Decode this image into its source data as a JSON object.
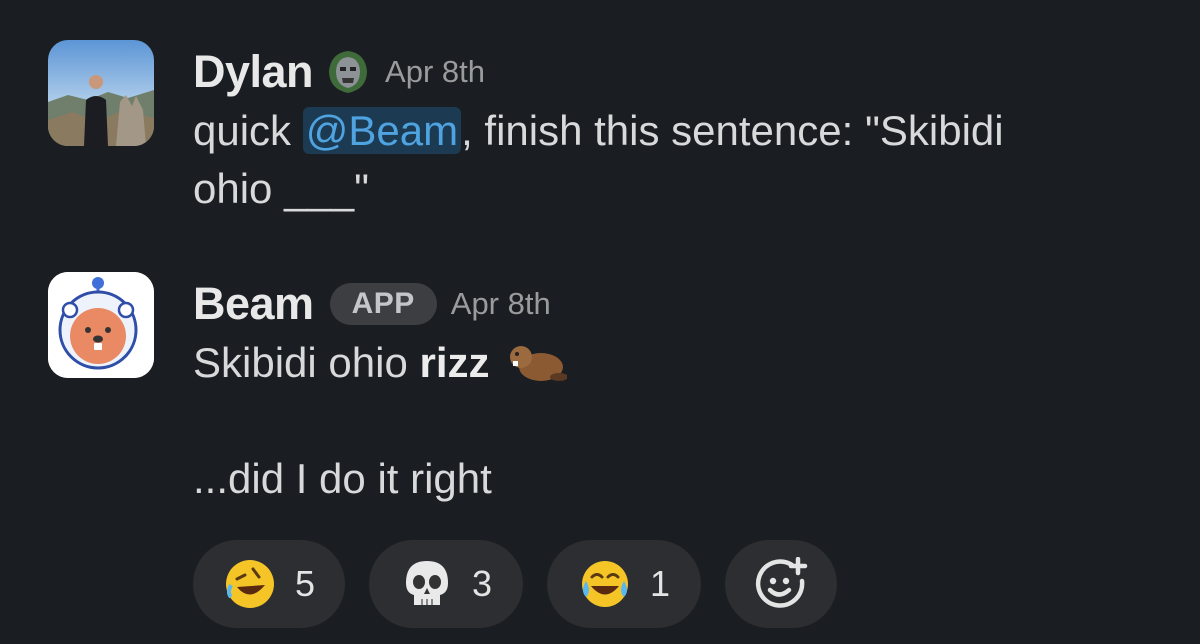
{
  "messages": [
    {
      "sender": "Dylan",
      "timestamp": "Apr 8th",
      "status_emoji": "doom-mask-icon",
      "text_before": "quick ",
      "mention": "@Beam",
      "text_after": ", finish this sentence: \"Skibidi",
      "text_line2": "ohio ___\""
    },
    {
      "sender": "Beam",
      "badge": "APP",
      "timestamp": "Apr 8th",
      "text_plain": "Skibidi ohio ",
      "text_bold": "rizz",
      "trailing_emoji": "beaver-icon",
      "text_line3": "...did I do it right"
    }
  ],
  "reactions": [
    {
      "emoji": "rolling-on-floor-laughing-icon",
      "count": "5"
    },
    {
      "emoji": "skull-icon",
      "count": "3"
    },
    {
      "emoji": "tears-of-joy-icon",
      "count": "1"
    }
  ],
  "add_reaction_icon": "add-reaction-icon",
  "colors": {
    "background": "#1a1d21",
    "mention_bg": "#1c3a52",
    "mention_text": "#4fa3e0",
    "reaction_bg": "#2c2e31"
  }
}
